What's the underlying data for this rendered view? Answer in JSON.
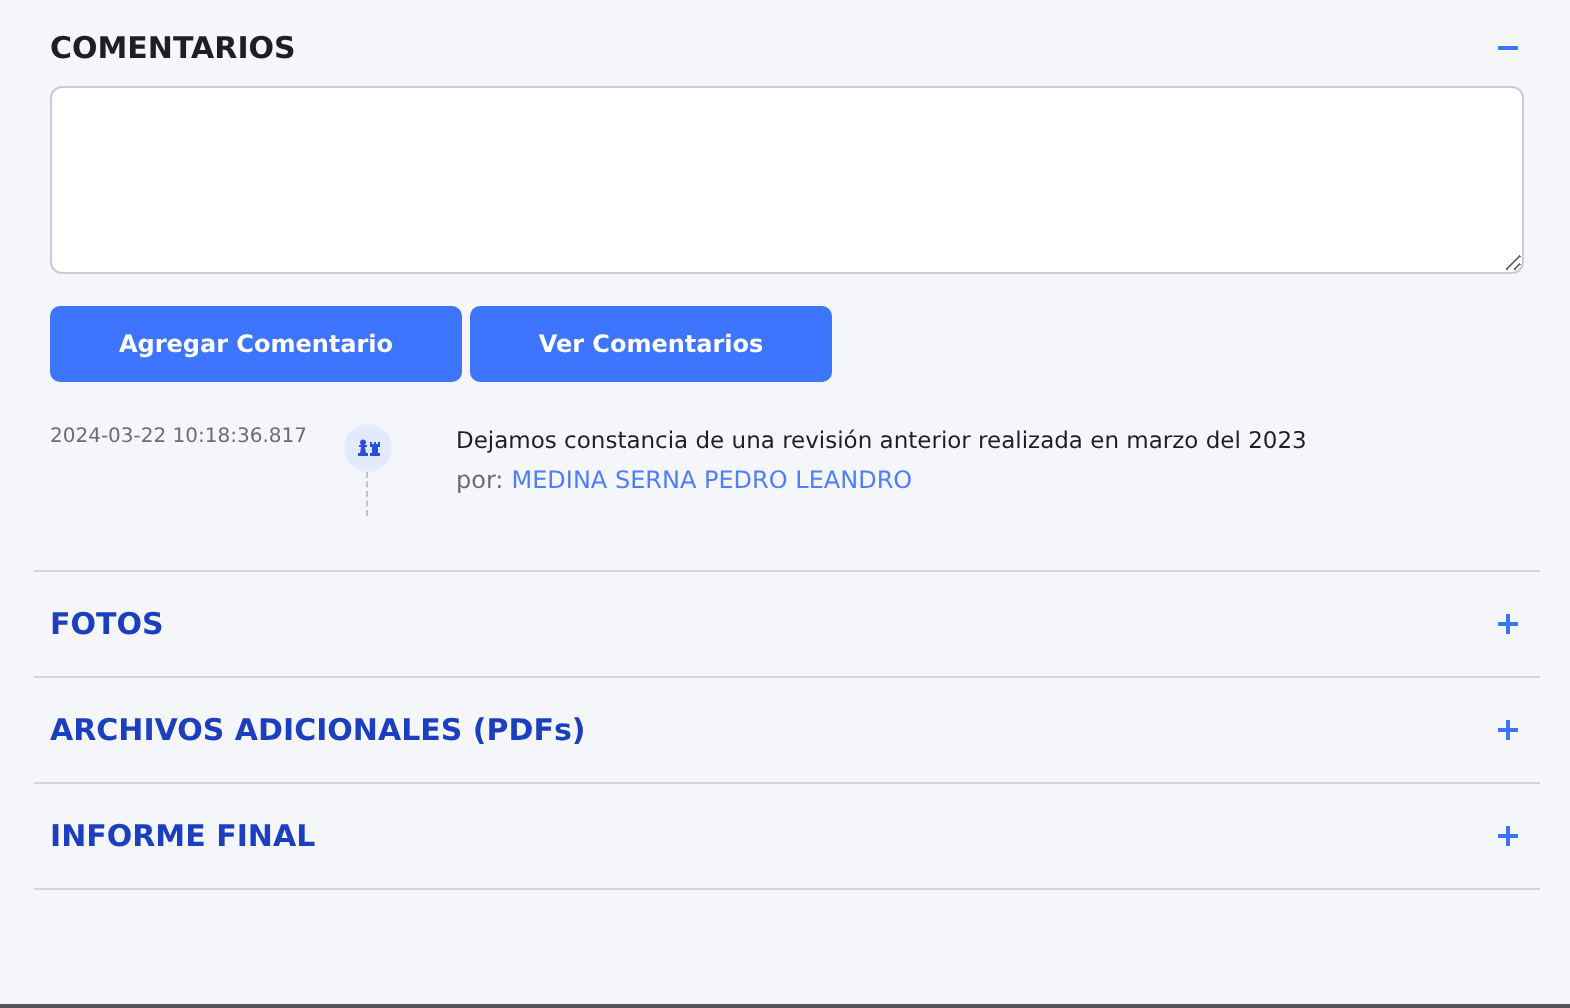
{
  "sections": [
    {
      "title": "COMENTARIOS",
      "expanded": true,
      "buttons": [
        "Agregar Comentario",
        "Ver Comentarios"
      ],
      "comments": [
        {
          "timestamp": "2024-03-22 10:18:36.817",
          "text": "Dejamos constancia de una revisión anterior realizada en marzo del 2023",
          "author_label": "por:",
          "author": "MEDINA SERNA PEDRO LEANDRO"
        }
      ]
    },
    {
      "title": "FOTOS",
      "expanded": false
    },
    {
      "title": "ARCHIVOS ADICIONALES (PDFs)",
      "expanded": false
    },
    {
      "title": "INFORME FINAL",
      "expanded": false
    }
  ]
}
